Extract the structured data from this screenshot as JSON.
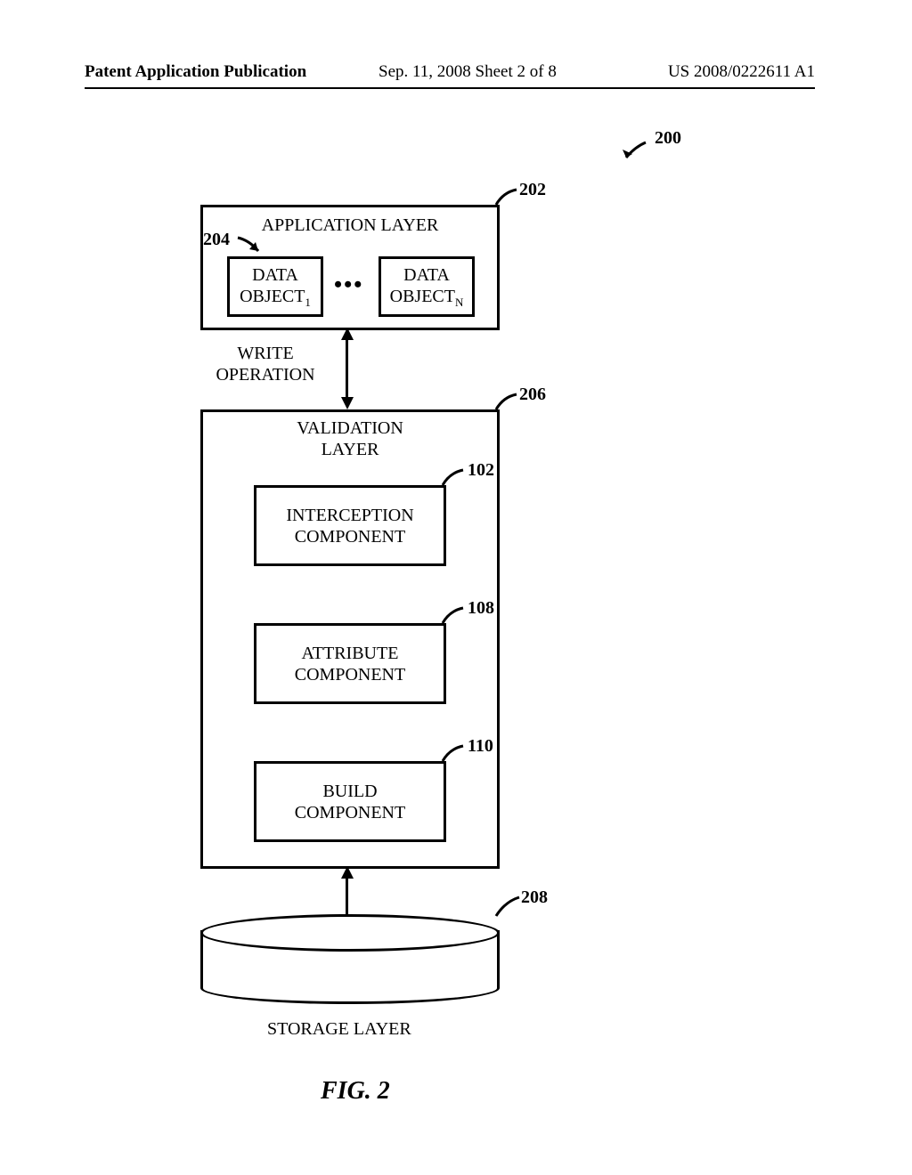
{
  "header": {
    "left": "Patent Application Publication",
    "center": "Sep. 11, 2008  Sheet 2 of 8",
    "right": "US 2008/0222611 A1"
  },
  "refs": {
    "r200": "200",
    "r202": "202",
    "r204": "204",
    "r206": "206",
    "r102": "102",
    "r108": "108",
    "r110": "110",
    "r208": "208"
  },
  "labels": {
    "app_layer": "APPLICATION LAYER",
    "data_obj_1_a": "DATA",
    "data_obj_1_b": "OBJECT",
    "sub1": "1",
    "dots": "•••",
    "data_obj_n_a": "DATA",
    "data_obj_n_b": "OBJECT",
    "subN": "N",
    "write_op_a": "WRITE",
    "write_op_b": "OPERATION",
    "val_layer_a": "VALIDATION",
    "val_layer_b": "LAYER",
    "intercept_a": "INTERCEPTION",
    "intercept_b": "COMPONENT",
    "attr_a": "ATTRIBUTE",
    "attr_b": "COMPONENT",
    "build_a": "BUILD",
    "build_b": "COMPONENT",
    "storage": "STORAGE LAYER",
    "fig": "FIG. 2"
  }
}
